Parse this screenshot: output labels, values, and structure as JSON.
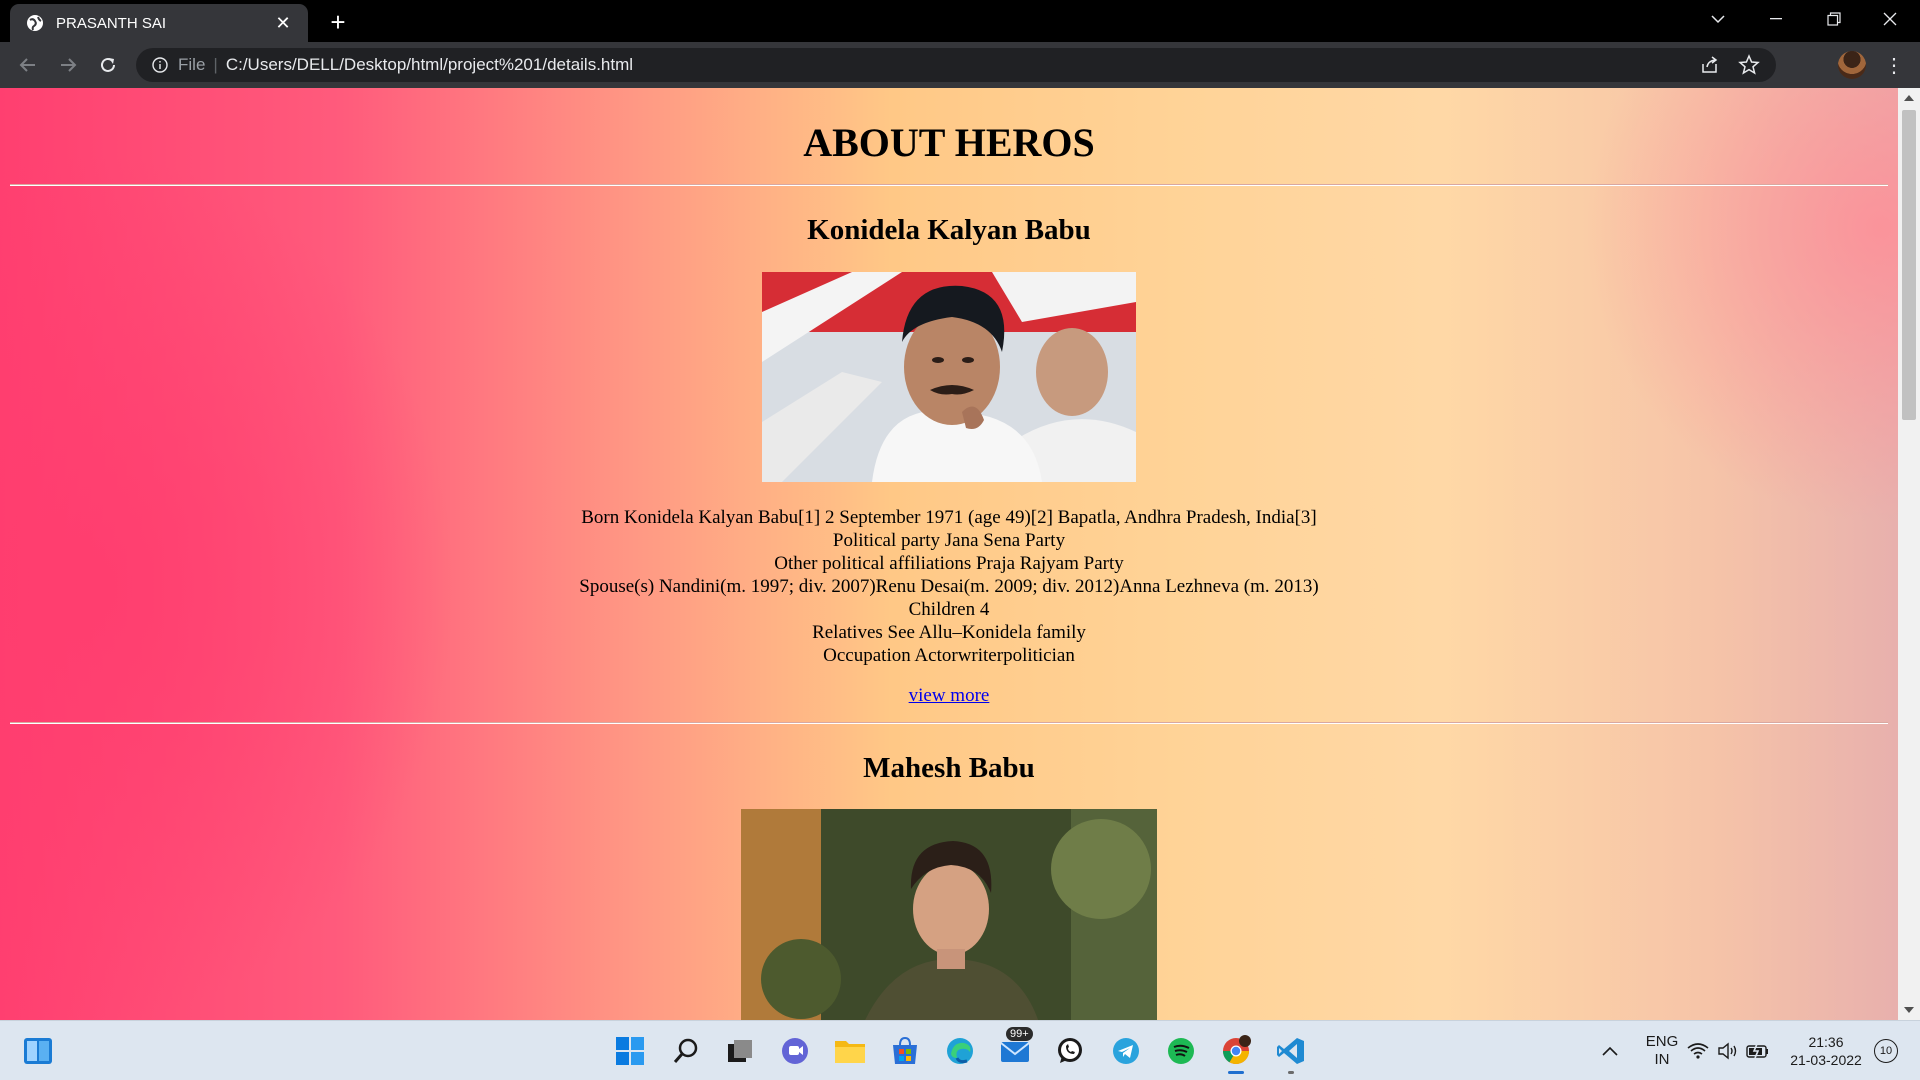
{
  "browser": {
    "tab_title": "PRASANTH SAI",
    "scheme_label": "File",
    "url": "C:/Users/DELL/Desktop/html/project%201/details.html"
  },
  "page": {
    "title": "ABOUT HEROS",
    "heroes": [
      {
        "name": "Konidela Kalyan Babu",
        "photo_alt": "Konidela Kalyan Babu photo",
        "details": [
          "Born Konidela Kalyan Babu[1] 2 September 1971 (age 49)[2] Bapatla, Andhra Pradesh, India[3]",
          "Political party Jana Sena Party",
          "Other political affiliations Praja Rajyam Party",
          "Spouse(s) Nandini(m. 1997; div. 2007)Renu Desai(m. 2009; div. 2012)Anna Lezhneva (m. 2013)",
          "Children 4",
          "Relatives See Allu–Konidela family",
          "Occupation Actorwriterpolitician"
        ],
        "link": "view more"
      },
      {
        "name": "Mahesh Babu",
        "photo_alt": "Mahesh Babu photo"
      }
    ]
  },
  "taskbar": {
    "mail_badge": "99+",
    "language": "ENG",
    "region": "IN",
    "time": "21:36",
    "date": "21-03-2022",
    "notifications": "10"
  }
}
